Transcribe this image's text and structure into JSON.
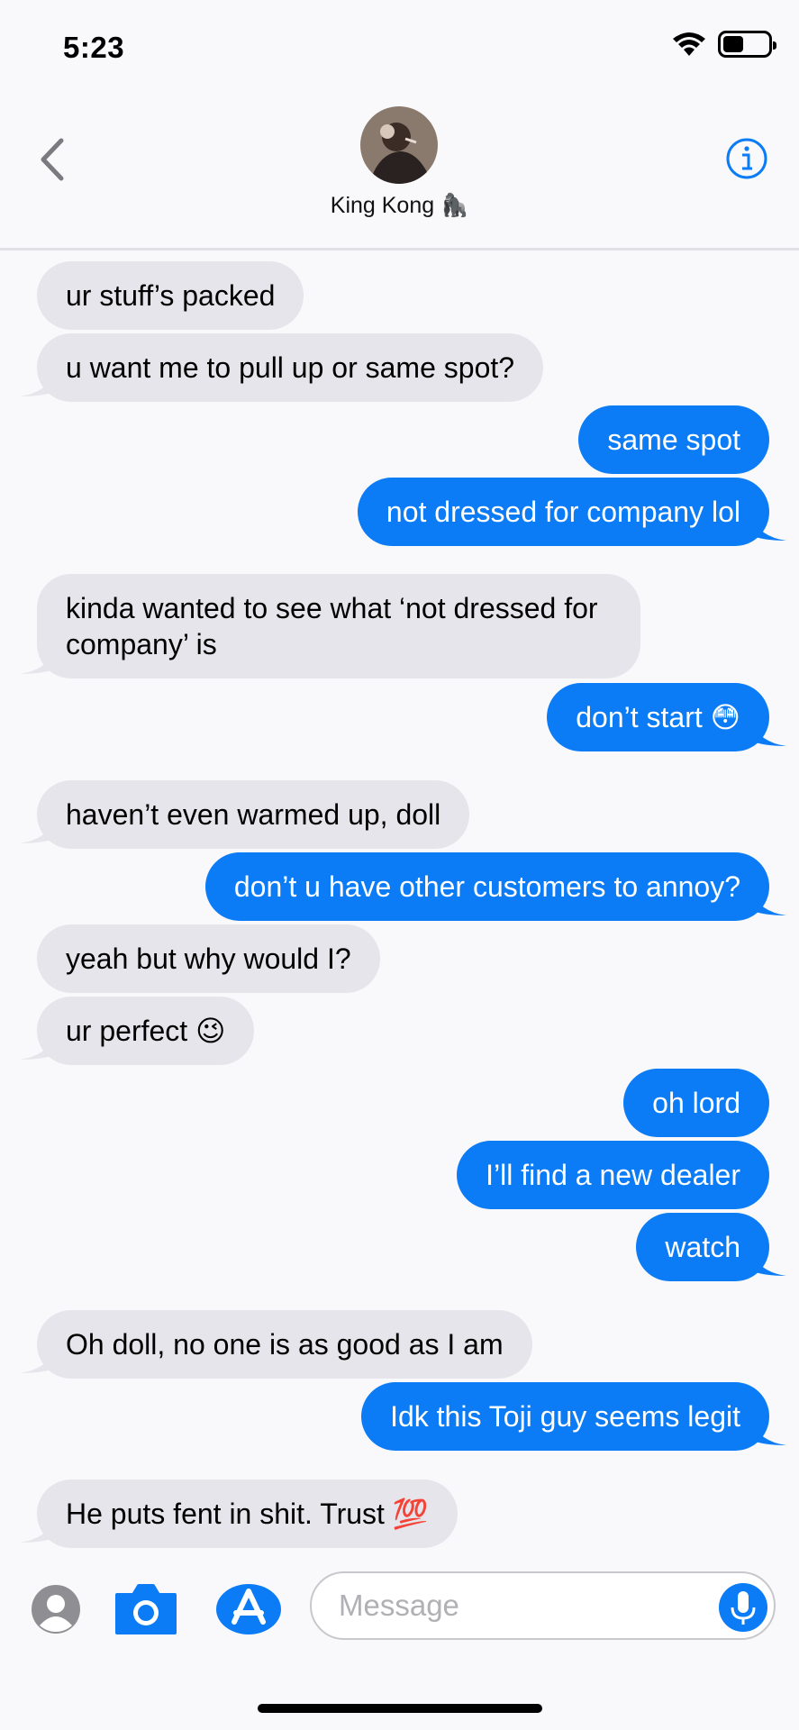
{
  "status_bar": {
    "time": "5:23"
  },
  "header": {
    "contact_name": "King Kong 🦍",
    "avatar_icon": "contact-avatar",
    "back_icon": "chevron-left-icon",
    "info_icon": "info-icon"
  },
  "messages": [
    {
      "dir": "in",
      "text": "ur stuff’s packed"
    },
    {
      "dir": "in",
      "text": "u want me to pull up or same spot?"
    },
    {
      "dir": "out",
      "text": "same spot"
    },
    {
      "dir": "out",
      "text": "not dressed for company lol"
    },
    {
      "dir": "in",
      "text": "kinda wanted to see what ‘not dressed for company’ is"
    },
    {
      "dir": "out",
      "text": "don’t start 😳"
    },
    {
      "dir": "in",
      "text": "haven’t even warmed up, doll"
    },
    {
      "dir": "out",
      "text": "don’t u have other customers to annoy?"
    },
    {
      "dir": "in",
      "text": "yeah but why would I?"
    },
    {
      "dir": "in",
      "text": "ur perfect 😉"
    },
    {
      "dir": "out",
      "text": "oh lord"
    },
    {
      "dir": "out",
      "text": "I’ll find a new dealer"
    },
    {
      "dir": "out",
      "text": "watch"
    },
    {
      "dir": "in",
      "text": "Oh doll, no one is as good as I am"
    },
    {
      "dir": "out",
      "text": "Idk this Toji guy seems legit"
    },
    {
      "dir": "in",
      "text": "He puts fent in shit. Trust 💯"
    }
  ],
  "composer": {
    "placeholder": "Message"
  },
  "colors": {
    "outgoing": "#0b7cf5",
    "incoming": "#e6e5eb",
    "accent": "#0b7cf5"
  }
}
